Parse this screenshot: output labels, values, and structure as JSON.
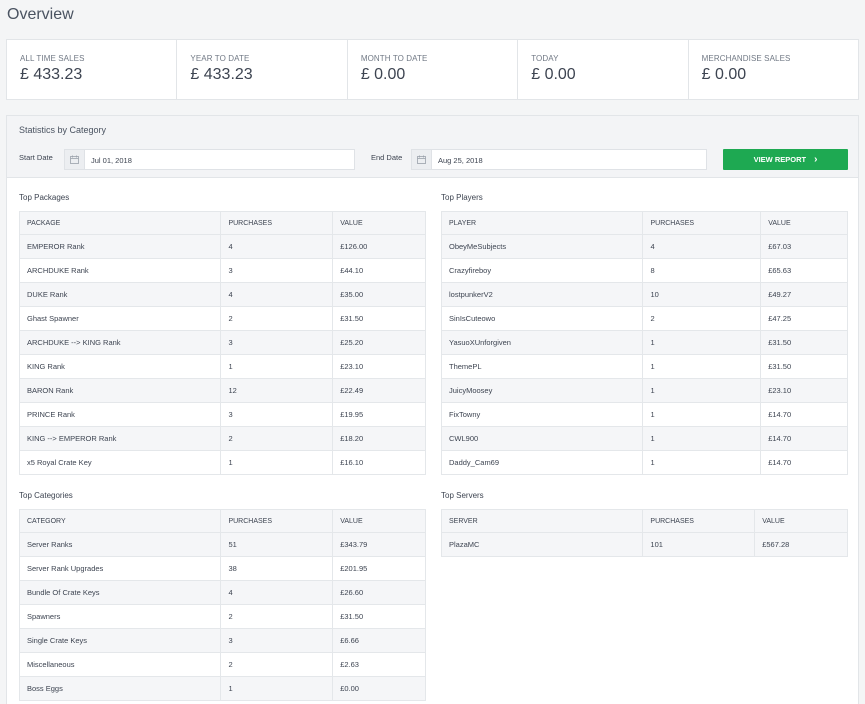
{
  "page": {
    "title": "Overview"
  },
  "stats": [
    {
      "label": "ALL TIME SALES",
      "value": "£ 433.23"
    },
    {
      "label": "YEAR TO DATE",
      "value": "£ 433.23"
    },
    {
      "label": "MONTH TO DATE",
      "value": "£ 0.00"
    },
    {
      "label": "TODAY",
      "value": "£ 0.00"
    },
    {
      "label": "MERCHANDISE SALES",
      "value": "£ 0.00"
    }
  ],
  "filters": {
    "title": "Statistics by Category",
    "start_label": "Start Date",
    "start_value": "Jul 01, 2018",
    "end_label": "End Date",
    "end_value": "Aug 25, 2018",
    "button_label": "VIEW REPORT",
    "button_color": "#1ea952"
  },
  "top_packages": {
    "title": "Top Packages",
    "headers": [
      "PACKAGE",
      "PURCHASES",
      "VALUE"
    ],
    "rows": [
      [
        "EMPEROR Rank",
        "4",
        "£126.00"
      ],
      [
        "ARCHDUKE Rank",
        "3",
        "£44.10"
      ],
      [
        "DUKE Rank",
        "4",
        "£35.00"
      ],
      [
        "Ghast Spawner",
        "2",
        "£31.50"
      ],
      [
        "ARCHDUKE --> KING Rank",
        "3",
        "£25.20"
      ],
      [
        "KING Rank",
        "1",
        "£23.10"
      ],
      [
        "BARON Rank",
        "12",
        "£22.49"
      ],
      [
        "PRINCE Rank",
        "3",
        "£19.95"
      ],
      [
        "KING --> EMPEROR Rank",
        "2",
        "£18.20"
      ],
      [
        "x5 Royal Crate Key",
        "1",
        "£16.10"
      ]
    ]
  },
  "top_players": {
    "title": "Top Players",
    "headers": [
      "PLAYER",
      "PURCHASES",
      "VALUE"
    ],
    "rows": [
      [
        "ObeyMeSubjects",
        "4",
        "£67.03"
      ],
      [
        "Crazyfireboy",
        "8",
        "£65.63"
      ],
      [
        "lostpunkerV2",
        "10",
        "£49.27"
      ],
      [
        "SinIsCuteowo",
        "2",
        "£47.25"
      ],
      [
        "YasuoXUnforgiven",
        "1",
        "£31.50"
      ],
      [
        "ThemePL",
        "1",
        "£31.50"
      ],
      [
        "JuicyMoosey",
        "1",
        "£23.10"
      ],
      [
        "FixTowny",
        "1",
        "£14.70"
      ],
      [
        "CWL900",
        "1",
        "£14.70"
      ],
      [
        "Daddy_Cam69",
        "1",
        "£14.70"
      ]
    ]
  },
  "top_categories": {
    "title": "Top Categories",
    "headers": [
      "CATEGORY",
      "PURCHASES",
      "VALUE"
    ],
    "rows": [
      [
        "Server Ranks",
        "51",
        "£343.79"
      ],
      [
        "Server Rank Upgrades",
        "38",
        "£201.95"
      ],
      [
        "Bundle Of Crate Keys",
        "4",
        "£26.60"
      ],
      [
        "Spawners",
        "2",
        "£31.50"
      ],
      [
        "Single Crate Keys",
        "3",
        "£6.66"
      ],
      [
        "Miscellaneous",
        "2",
        "£2.63"
      ],
      [
        "Boss Eggs",
        "1",
        "£0.00"
      ]
    ]
  },
  "top_servers": {
    "title": "Top Servers",
    "headers": [
      "SERVER",
      "PURCHASES",
      "VALUE"
    ],
    "rows": [
      [
        "PlazaMC",
        "101",
        "£567.28"
      ]
    ]
  }
}
